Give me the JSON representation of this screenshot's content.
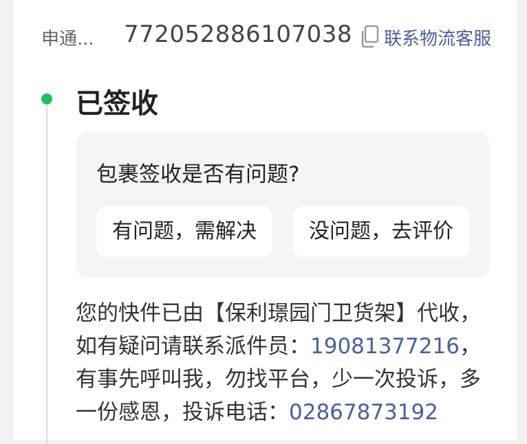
{
  "logistics": {
    "carrier_name": "申通...",
    "tracking_number": "772052886107038",
    "copy_icon": "copy-icon",
    "contact_label": "联系物流客服"
  },
  "timeline": {
    "status_title": "已签收",
    "status_color": "#1fbf5c"
  },
  "feedback": {
    "question": "包裹签收是否有问题?",
    "problem_button": "有问题，需解决",
    "ok_button": "没问题，去评价"
  },
  "detail": {
    "part1": "您的快件已由【保利璟园门卫货架】代收，如有疑问请联系派件员：",
    "courier_phone": "19081377216",
    "part2": "，有事先呼叫我，勿找平台，少一次投诉，多一份感恩，投诉电话：",
    "complaint_phone": "02867873192"
  },
  "colors": {
    "link": "#4a5f9d",
    "status_dot": "#1fbf5c"
  }
}
